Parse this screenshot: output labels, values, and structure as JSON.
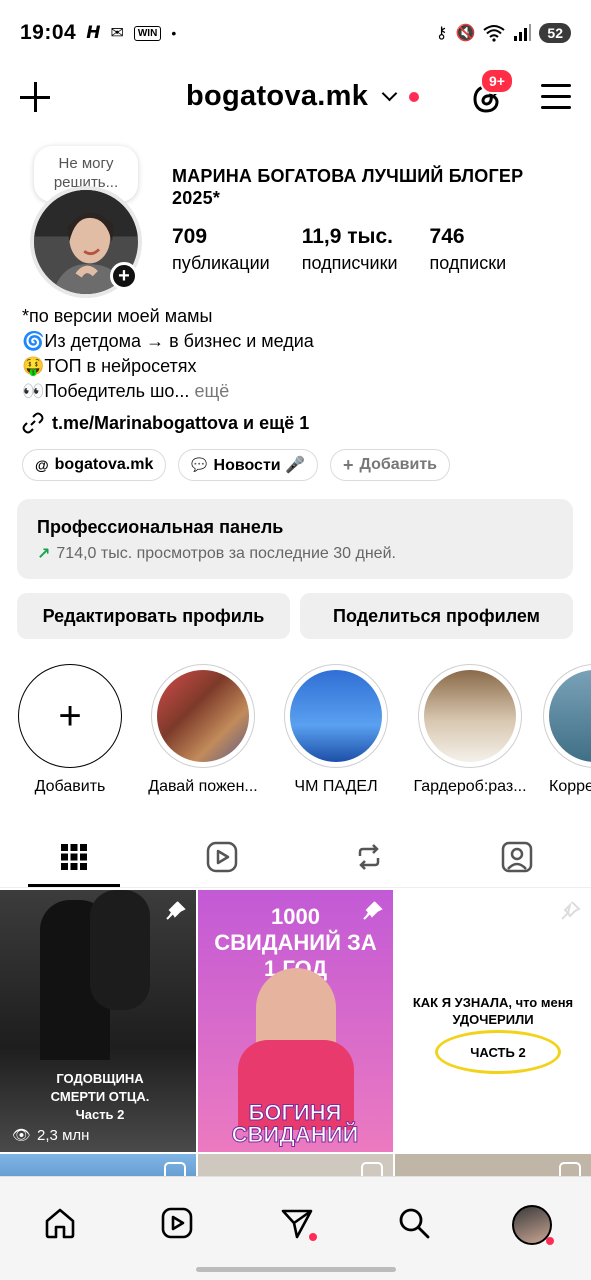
{
  "status_bar": {
    "time": "19:04",
    "battery": "52",
    "left_icons": [
      "h-icon",
      "mail-icon",
      "win-icon",
      "dot-icon"
    ],
    "right_icons": [
      "key-icon",
      "mute-icon",
      "wifi-icon",
      "signal-icon"
    ]
  },
  "header": {
    "username": "bogatova.mk",
    "notification_badge": "9+"
  },
  "profile": {
    "note": "Не могу решить...",
    "name": "МАРИНА БОГАТОВА ЛУЧШИЙ БЛОГЕР 2025*",
    "stats": [
      {
        "value": "709",
        "label": "публикации"
      },
      {
        "value": "11,9 тыс.",
        "label": "подписчики"
      },
      {
        "value": "746",
        "label": "подписки"
      }
    ],
    "bio_lines": [
      "*по версии моей мамы",
      "🌀Из детдома → в бизнес и медиа",
      "🤑ТОП в нейросетях"
    ],
    "bio_last": "👀Победитель шо...",
    "bio_more": " ещё",
    "link": "t.me/Marinabogattova и ещё 1"
  },
  "chips": [
    {
      "label": "bogatova.mk"
    },
    {
      "label": "Новости 🎤"
    },
    {
      "label": "Добавить"
    }
  ],
  "pro_panel": {
    "title": "Профессиональная панель",
    "subtitle": "714,0 тыс. просмотров за последние 30 дней."
  },
  "buttons": {
    "edit": "Редактировать профиль",
    "share": "Поделиться профилем"
  },
  "highlights": [
    {
      "label": "Добавить"
    },
    {
      "label": "Давай пожен..."
    },
    {
      "label": "ЧМ ПАДЕЛ"
    },
    {
      "label": "Гардероб:раз..."
    },
    {
      "label": "Корре"
    }
  ],
  "grid": {
    "post1": {
      "caption": "ГОДОВЩИНА СМЕРТИ ОТЦА. Часть 2",
      "views": "2,3 млн"
    },
    "post2": {
      "title": "1000 СВИДАНИЙ ЗА 1 ГОД",
      "bottom": "БОГИНЯ СВИДАНИЙ"
    },
    "post3": {
      "title": "КАК Я УЗНАЛА, что меня УДОЧЕРИЛИ",
      "part": "ЧАСТЬ 2"
    }
  },
  "colors": {
    "accent_red": "#ff2d55",
    "panel_bg": "#efefef",
    "green": "#16a34a"
  }
}
